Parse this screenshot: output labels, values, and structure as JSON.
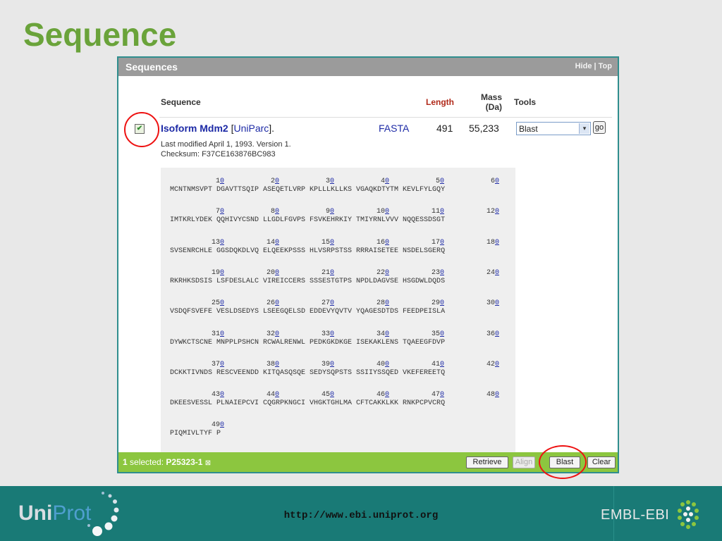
{
  "slide": {
    "title": "Sequence"
  },
  "panel": {
    "title": "Sequences",
    "hide": "Hide",
    "sep": "|",
    "top": "Top",
    "columns": {
      "sequence": "Sequence",
      "length": "Length",
      "mass_line1": "Mass",
      "mass_line2": "(Da)",
      "tools": "Tools"
    },
    "checkbox_mark": "✔",
    "isoform": {
      "name": "Isoform Mdm2",
      "uniparc_open": "[",
      "uniparc": "UniParc",
      "uniparc_close": "].",
      "fasta": "FASTA",
      "length": "491",
      "mass": "55,233",
      "tool_selected": "Blast",
      "tool_arrow": "▾",
      "go": "go",
      "last_modified": "Last modified April 1, 1993. Version 1.",
      "checksum": "Checksum: F37CE163876BC983"
    },
    "sequence_blocks": [
      {
        "nums": [
          "10",
          "20",
          "30",
          "40",
          "50",
          "60"
        ],
        "residues": "MCNTNMSVPT DGAVTTSQIP ASEQETLVRP KPLLLKLLKS VGAQKDTYTM KEVLFYLGQY"
      },
      {
        "nums": [
          "70",
          "80",
          "90",
          "100",
          "110",
          "120"
        ],
        "residues": "IMTKRLYDEK QQHIVYCSND LLGDLFGVPS FSVKEHRKIY TMIYRNLVVV NQQESSDSGT"
      },
      {
        "nums": [
          "130",
          "140",
          "150",
          "160",
          "170",
          "180"
        ],
        "residues": "SVSENRCHLE GGSDQKDLVQ ELQEEKPSSS HLVSRPSTSS RRRAISETEE NSDELSGERQ"
      },
      {
        "nums": [
          "190",
          "200",
          "210",
          "220",
          "230",
          "240"
        ],
        "residues": "RKRHKSDSIS LSFDESLALC VIREICCERS SSSESTGTPS NPDLDAGVSE HSGDWLDQDS"
      },
      {
        "nums": [
          "250",
          "260",
          "270",
          "280",
          "290",
          "300"
        ],
        "residues": "VSDQFSVEFE VESLDSEDYS LSEEGQELSD EDDEVYQVTV YQAGESDTDS FEEDPEISLA"
      },
      {
        "nums": [
          "310",
          "320",
          "330",
          "340",
          "350",
          "360"
        ],
        "residues": "DYWKCTSCNE MNPPLPSHCN RCWALRENWL PEDKGKDKGE ISEKAKLENS TQAEEGFDVP"
      },
      {
        "nums": [
          "370",
          "380",
          "390",
          "400",
          "410",
          "420"
        ],
        "residues": "DCKKTIVNDS RESCVEENDD KITQASQSQE SEDYSQPSTS SSIIYSSQED VKEFEREETQ"
      },
      {
        "nums": [
          "430",
          "440",
          "450",
          "460",
          "470",
          "480"
        ],
        "residues": "DKEESVESSL PLNAIEPCVI CQGRPKNGCI VHGKTGHLMA CFTCAKKLKK RNKPCPVCRQ"
      },
      {
        "nums": [
          "490"
        ],
        "residues": "PIQMIVLTYF P"
      }
    ],
    "bottom": {
      "count": "1",
      "selected_label": "selected:",
      "accession": "P25323-1",
      "remove_icon": "⊠",
      "retrieve": "Retrieve",
      "align": "Align",
      "blast": "Blast",
      "clear": "Clear"
    }
  },
  "footer": {
    "url": "http://www.ebi.uniprot.org",
    "logo_uni": "Uni",
    "logo_prot": "Prot",
    "embl": "EMBL-EBI"
  }
}
